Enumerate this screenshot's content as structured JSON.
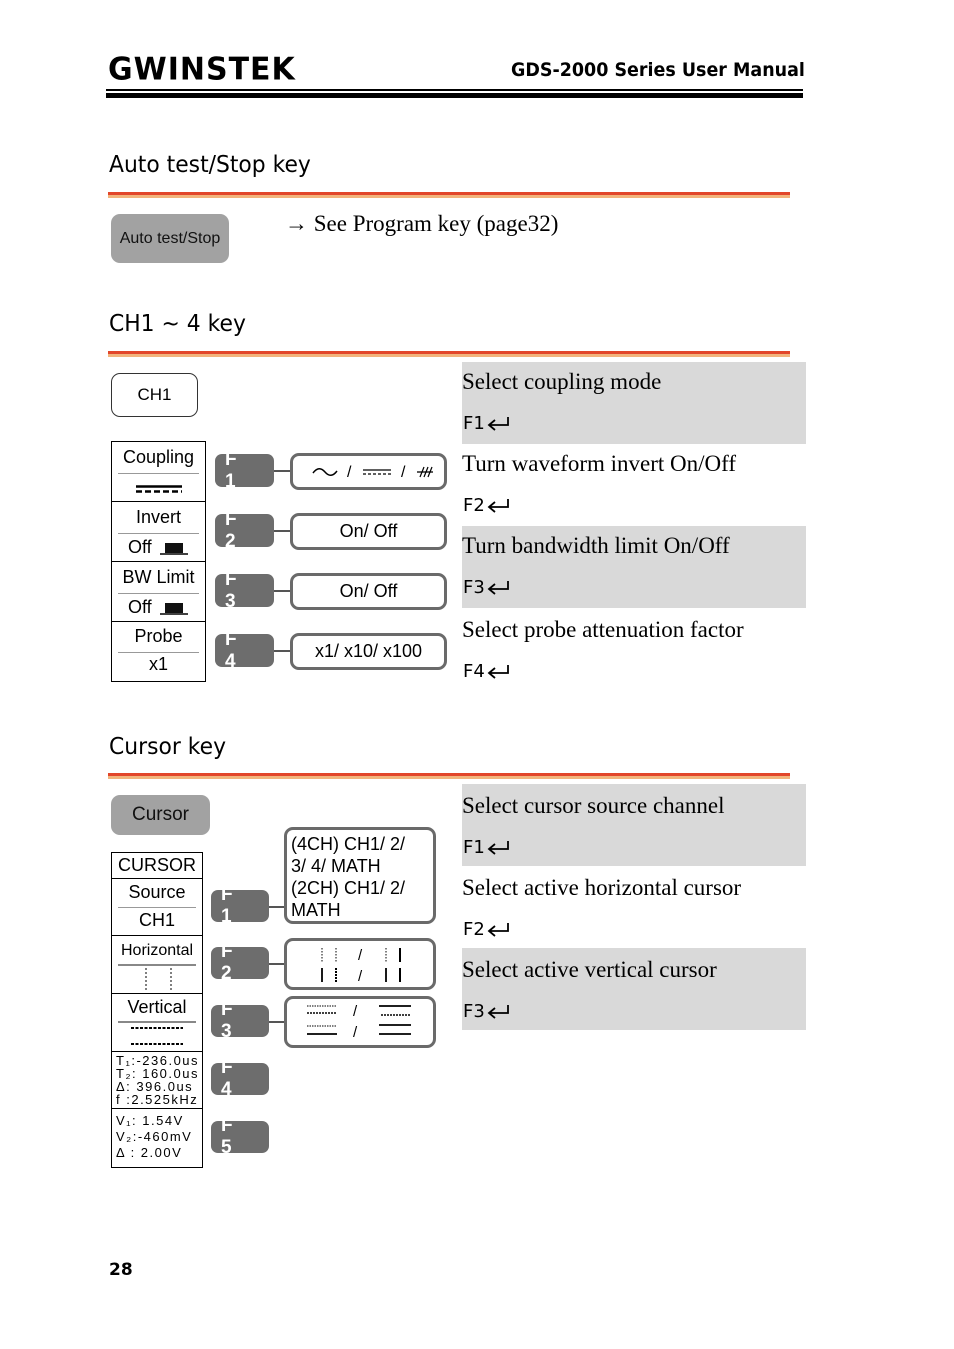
{
  "header": {
    "logo": "GWINSTEK",
    "doc_title": "GDS-2000 Series User Manual"
  },
  "sections": {
    "auto_test": {
      "title": "Auto test/Stop key",
      "key_label": "Auto test/Stop",
      "reference": "→ See Program key (page32)"
    },
    "ch": {
      "title": "CH1 ~ 4 key",
      "key_label": "CH1",
      "menu": [
        {
          "label": "Coupling",
          "value": "DC"
        },
        {
          "label": "Invert",
          "value": "Off"
        },
        {
          "label": "BW Limit",
          "value": "Off"
        },
        {
          "label": "Probe",
          "value": "x1"
        }
      ],
      "fbuttons": [
        "F 1",
        "F 2",
        "F 3",
        "F 4"
      ],
      "options": [
        "AC / DC / GND",
        "On/ Off",
        "On/ Off",
        "x1/ x10/ x100"
      ],
      "descriptions": [
        {
          "text": "Select coupling mode",
          "fkey": "F1"
        },
        {
          "text": "Turn waveform invert On/Off",
          "fkey": "F2"
        },
        {
          "text": "Turn bandwidth limit On/Off",
          "fkey": "F3"
        },
        {
          "text": "Select probe attenuation factor",
          "fkey": "F4"
        }
      ]
    },
    "cursor": {
      "title": "Cursor key",
      "key_label": "Cursor",
      "menu_title": "CURSOR",
      "source_label": "Source",
      "source_value": "CH1",
      "horizontal_label": "Horizontal",
      "vertical_label": "Vertical",
      "time_readout": {
        "t1": "T₁:-236.0us",
        "t2": "T₂: 160.0us",
        "delta": "Δ:  396.0us",
        "freq": "f :2.525kHz"
      },
      "volt_readout": {
        "v1": "V₁:  1.54V",
        "v2": "V₂:-460mV",
        "delta": "Δ :  2.00V"
      },
      "fbuttons": [
        "F 1",
        "F 2",
        "F 3",
        "F 4",
        "F 5"
      ],
      "source_options": [
        "(4CH) CH1/ 2/",
        "3/ 4/ MATH",
        "(2CH) CH1/ 2/",
        "MATH"
      ],
      "slash": "/",
      "descriptions": [
        {
          "text": "Select cursor source channel",
          "fkey": "F1"
        },
        {
          "text": "Select active horizontal cursor",
          "fkey": "F2"
        },
        {
          "text": "Select active vertical cursor",
          "fkey": "F3"
        }
      ]
    }
  },
  "page_number": "28"
}
